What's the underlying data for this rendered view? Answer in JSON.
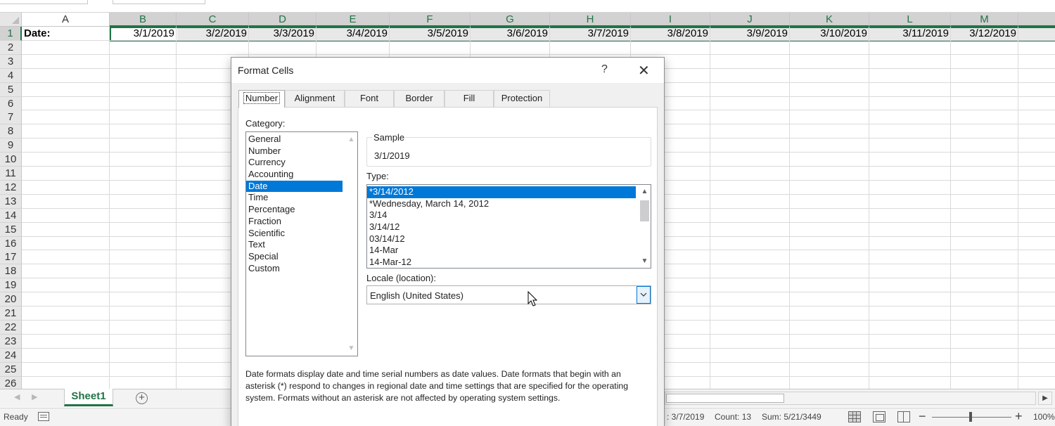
{
  "sheet": {
    "columns": [
      "A",
      "B",
      "C",
      "D",
      "E",
      "F",
      "G",
      "H",
      "I",
      "J",
      "K",
      "L",
      "M"
    ],
    "rows": [
      "1",
      "2",
      "3",
      "4",
      "5",
      "6",
      "7",
      "8",
      "9",
      "10",
      "11",
      "12",
      "13",
      "14",
      "15",
      "16",
      "17",
      "18",
      "19",
      "20",
      "21",
      "22",
      "23",
      "24",
      "25",
      "26"
    ],
    "a1": "Date:",
    "row1_dates": [
      "3/1/2019",
      "3/2/2019",
      "3/3/2019",
      "3/4/2019",
      "3/5/2019",
      "3/6/2019",
      "3/7/2019",
      "3/8/2019",
      "3/9/2019",
      "3/10/2019",
      "3/11/2019",
      "3/12/2019"
    ],
    "tab_name": "Sheet1",
    "add_sheet_glyph": "+",
    "scroll_left": "◀",
    "scroll_right": "▶"
  },
  "status": {
    "ready": "Ready",
    "average": ": 3/7/2019",
    "count": "Count: 13",
    "sum": "Sum: 5/21/3449",
    "zoom_minus": "−",
    "zoom_plus": "+",
    "zoom": "100%"
  },
  "dialog": {
    "title": "Format Cells",
    "help": "?",
    "close": "✕",
    "tabs": [
      "Number",
      "Alignment",
      "Font",
      "Border",
      "Fill",
      "Protection"
    ],
    "category_label": "Category:",
    "categories": [
      "General",
      "Number",
      "Currency",
      "Accounting",
      "Date",
      "Time",
      "Percentage",
      "Fraction",
      "Scientific",
      "Text",
      "Special",
      "Custom"
    ],
    "selected_category": "Date",
    "sample_label": "Sample",
    "sample_value": "3/1/2019",
    "type_label": "Type:",
    "types": [
      "*3/14/2012",
      "*Wednesday, March 14, 2012",
      "3/14",
      "3/14/12",
      "03/14/12",
      "14-Mar",
      "14-Mar-12"
    ],
    "selected_type": "*3/14/2012",
    "locale_label": "Locale (location):",
    "locale_value": "English (United States)",
    "description": "Date formats display date and time serial numbers as date values.  Date formats that begin with an asterisk (*) respond to changes in regional date and time settings that are specified for the operating system. Formats without an asterisk are not affected by operating system settings."
  },
  "colors": {
    "excel_green": "#217346",
    "selection_blue": "#0078d7"
  },
  "icons": {
    "help": "question-mark-icon",
    "close": "close-icon",
    "dropdown": "chevron-down-icon",
    "add_sheet": "plus-circle-icon",
    "cursor": "mouse-pointer-icon"
  }
}
